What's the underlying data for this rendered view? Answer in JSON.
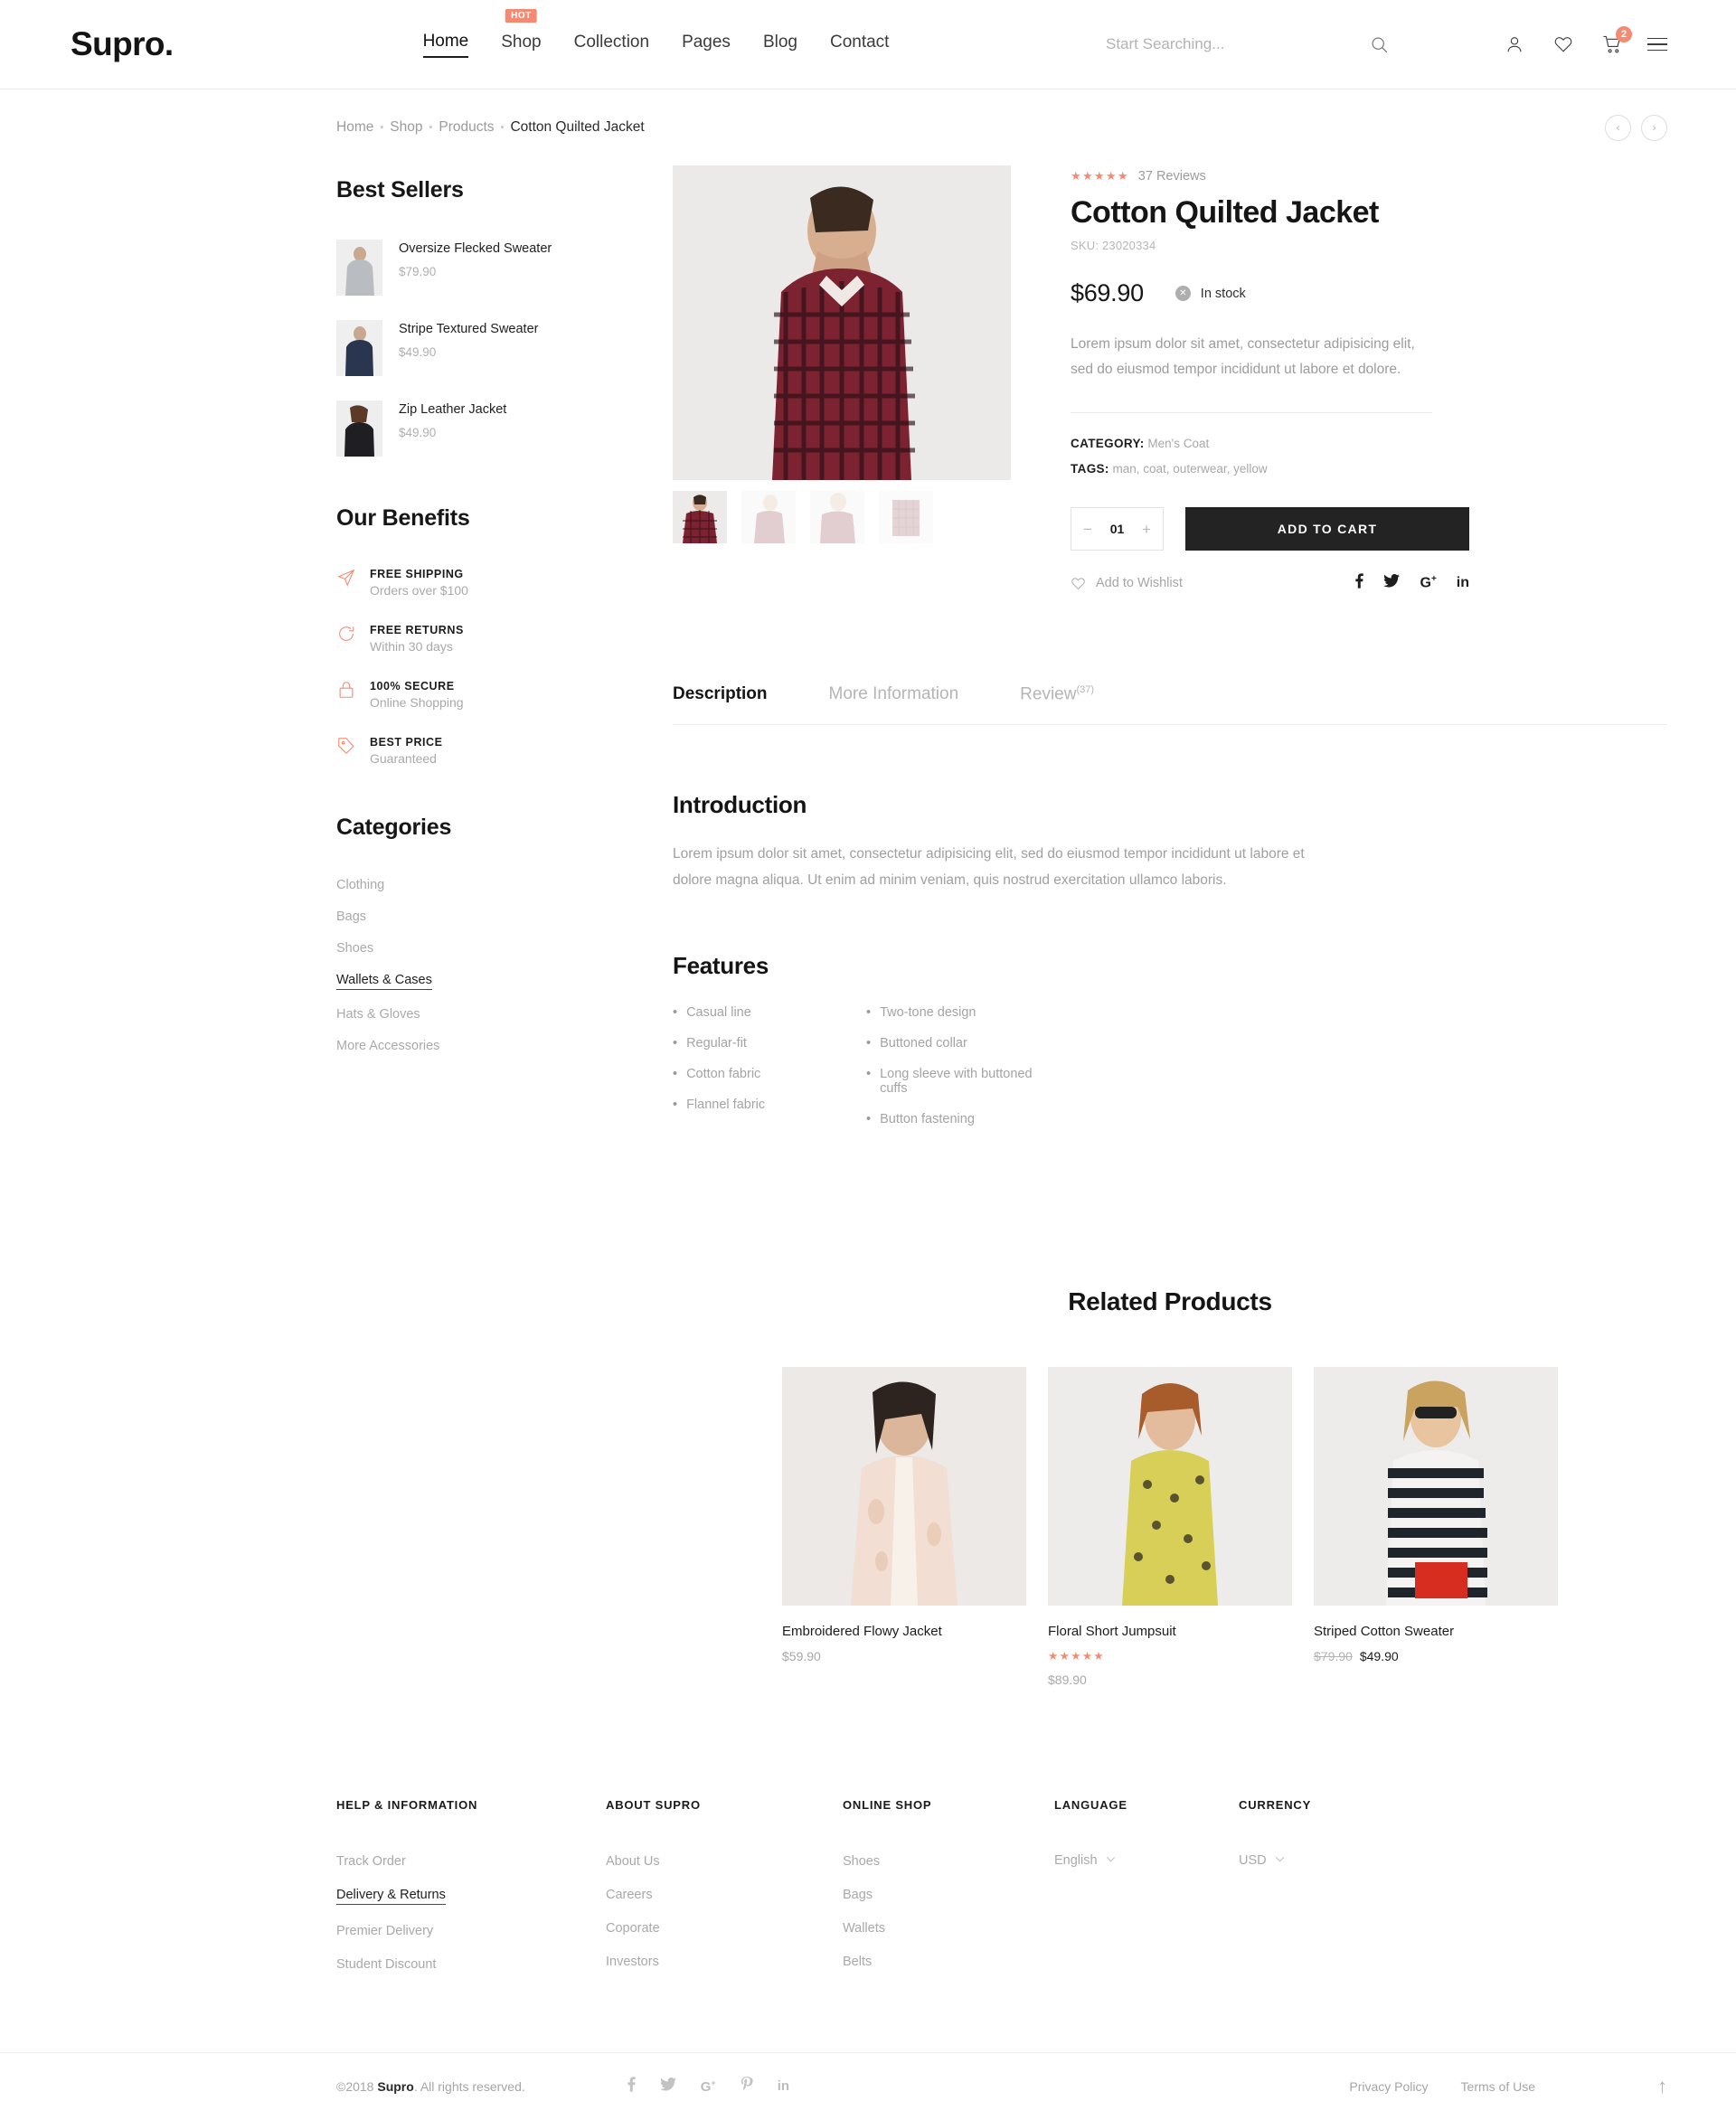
{
  "brand": {
    "logo": "Supro."
  },
  "nav": {
    "items": [
      {
        "label": "Home",
        "active": true,
        "badge": null
      },
      {
        "label": "Shop",
        "active": false,
        "badge": "HOT"
      },
      {
        "label": "Collection",
        "active": false,
        "badge": null
      },
      {
        "label": "Pages",
        "active": false,
        "badge": null
      },
      {
        "label": "Blog",
        "active": false,
        "badge": null
      },
      {
        "label": "Contact",
        "active": false,
        "badge": null
      }
    ]
  },
  "search": {
    "placeholder": "Start Searching...",
    "value": ""
  },
  "header_icons": {
    "account": "user-icon",
    "wishlist": "heart-icon",
    "cart": "cart-icon",
    "cart_count": "2",
    "menu": "hamburger-icon"
  },
  "breadcrumb": {
    "items": [
      "Home",
      "Shop",
      "Products"
    ],
    "current": "Cotton Quilted Jacket",
    "separator": "▪"
  },
  "pager": {
    "prev": "‹",
    "next": "›"
  },
  "sidebar": {
    "best_sellers": {
      "title": "Best Sellers",
      "items": [
        {
          "name": "Oversize Flecked Sweater",
          "price": "$79.90"
        },
        {
          "name": "Stripe Textured Sweater",
          "price": "$49.90"
        },
        {
          "name": "Zip Leather Jacket",
          "price": "$49.90"
        }
      ]
    },
    "benefits": {
      "title": "Our Benefits",
      "accent": "#f58a72",
      "items": [
        {
          "icon": "paper-plane-icon",
          "title": "FREE SHIPPING",
          "sub": "Orders over $100"
        },
        {
          "icon": "refresh-icon",
          "title": "FREE RETURNS",
          "sub": "Within 30 days"
        },
        {
          "icon": "lock-icon",
          "title": "100% SECURE",
          "sub": "Online Shopping"
        },
        {
          "icon": "tag-icon",
          "title": "BEST PRICE",
          "sub": "Guaranteed"
        }
      ]
    },
    "categories": {
      "title": "Categories",
      "items": [
        {
          "label": "Clothing",
          "active": false
        },
        {
          "label": "Bags",
          "active": false
        },
        {
          "label": "Shoes",
          "active": false
        },
        {
          "label": "Wallets & Cases",
          "active": true
        },
        {
          "label": "Hats & Gloves",
          "active": false
        },
        {
          "label": "More Accessories",
          "active": false
        }
      ]
    }
  },
  "product": {
    "rating_stars": "★★★★★",
    "reviews_label": "37 Reviews",
    "title": "Cotton Quilted Jacket",
    "sku": "SKU: 23020334",
    "price": "$69.90",
    "stock_icon": "✕",
    "stock_label": "In stock",
    "description": "Lorem ipsum dolor sit amet, consectetur adipisicing elit, sed do eiusmod tempor incididunt ut labore et dolore.",
    "category_label": "CATEGORY:",
    "category_value": "Men's Coat",
    "tags_label": "TAGS:",
    "tags_value": "man, coat, outerwear, yellow",
    "qty_minus": "−",
    "qty_value": "01",
    "qty_plus": "+",
    "add_to_cart": "ADD TO CART",
    "wishlist": "Add to Wishlist",
    "socials": [
      "f",
      "ƒ",
      "G+",
      "in"
    ],
    "thumbs": [
      {
        "name": "front-view",
        "active": true
      },
      {
        "name": "back-view",
        "active": false
      },
      {
        "name": "detail-view",
        "active": false
      },
      {
        "name": "folded-view",
        "active": false
      }
    ]
  },
  "tabs": [
    {
      "label": "Description",
      "sup": "",
      "active": true
    },
    {
      "label": "More Information",
      "sup": "",
      "active": false
    },
    {
      "label": "Review",
      "sup": "(37)",
      "active": false
    }
  ],
  "description_tab": {
    "intro_heading": "Introduction",
    "intro_text": "Lorem ipsum dolor sit amet, consectetur adipisicing elit, sed do eiusmod tempor incididunt ut labore et dolore magna aliqua. Ut enim ad minim veniam, quis nostrud exercitation ullamco laboris.",
    "features_heading": "Features",
    "features_left": [
      "Casual line",
      "Regular-fit",
      "Cotton fabric",
      "Flannel fabric"
    ],
    "features_right": [
      "Two-tone design",
      "Buttoned collar",
      "Long sleeve with buttoned cuffs",
      "Button fastening"
    ]
  },
  "related": {
    "heading": "Related Products",
    "items": [
      {
        "name": "Embroidered Flowy Jacket",
        "price": "$59.90",
        "stars": null,
        "old_price": null
      },
      {
        "name": "Floral Short Jumpsuit",
        "price": "$89.90",
        "stars": "★★★★★",
        "old_price": null
      },
      {
        "name": "Striped Cotton Sweater",
        "price": "$49.90",
        "stars": null,
        "old_price": "$79.90"
      }
    ]
  },
  "footer": {
    "columns": [
      {
        "head": "HELP & INFORMATION",
        "links": [
          {
            "label": "Track Order",
            "active": false
          },
          {
            "label": "Delivery & Returns",
            "active": true
          },
          {
            "label": "Premier Delivery",
            "active": false
          },
          {
            "label": "Student Discount",
            "active": false
          }
        ]
      },
      {
        "head": "ABOUT SUPRO",
        "links": [
          {
            "label": "About Us",
            "active": false
          },
          {
            "label": "Careers",
            "active": false
          },
          {
            "label": "Coporate",
            "active": false
          },
          {
            "label": "Investors",
            "active": false
          }
        ]
      },
      {
        "head": "ONLINE SHOP",
        "links": [
          {
            "label": "Shoes",
            "active": false
          },
          {
            "label": "Bags",
            "active": false
          },
          {
            "label": "Wallets",
            "active": false
          },
          {
            "label": "Belts",
            "active": false
          }
        ]
      }
    ],
    "language": {
      "head": "LANGUAGE",
      "value": "English",
      "chevron": "∨"
    },
    "currency": {
      "head": "CURRENCY",
      "value": "USD",
      "chevron": "∨"
    }
  },
  "bottom": {
    "copyright_pre": "©2018 ",
    "copyright_brand": "Supro",
    "copyright_post": ". All rights reserved.",
    "socials": [
      "facebook-icon",
      "twitter-icon",
      "googleplus-icon",
      "pinterest-icon",
      "linkedin-icon"
    ],
    "links": [
      "Privacy Policy",
      "Terms of Use"
    ],
    "to_top": "↑"
  }
}
